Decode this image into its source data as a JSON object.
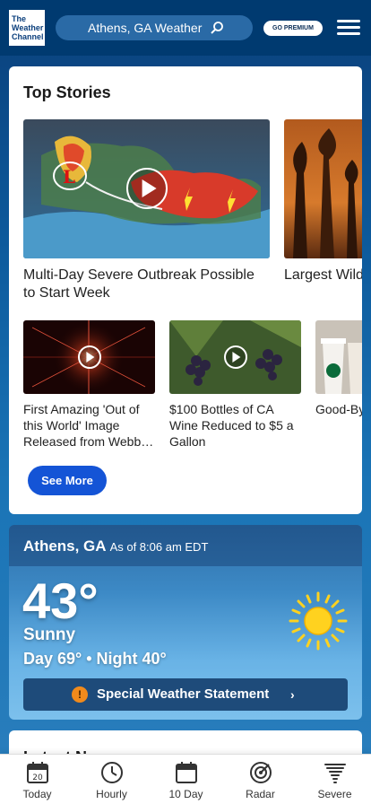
{
  "header": {
    "logo_lines": [
      "The",
      "Weather",
      "Channel"
    ],
    "search_text": "Athens, GA Weather",
    "premium_label": "GO PREMIUM"
  },
  "top_stories": {
    "title": "Top Stories",
    "featured": [
      {
        "caption": "Multi-Day Severe Outbreak Possible to Start Week",
        "video": true
      },
      {
        "caption": "Largest Wildfire... Continues to...",
        "video": false
      }
    ],
    "small": [
      {
        "caption": "First Amazing 'Out of this World' Image Released from Webb…",
        "video": true
      },
      {
        "caption": "$100 Bottles of CA Wine Reduced to $5 a Gallon",
        "video": true
      },
      {
        "caption": "Good-By... Cups at S...",
        "video": false
      }
    ],
    "see_more_label": "See More"
  },
  "current": {
    "location": "Athens, GA",
    "as_of": "As of 8:06 am EDT",
    "temperature": "43°",
    "condition": "Sunny",
    "day_night": "Day 69° • Night 40°",
    "alert_label": "Special Weather Statement",
    "alert_icon": "!",
    "chevron": "›"
  },
  "latest_news": {
    "title": "Latest News"
  },
  "bottom_nav": [
    {
      "label": "Today",
      "icon": "calendar-day-icon",
      "day_number": "20"
    },
    {
      "label": "Hourly",
      "icon": "clock-icon"
    },
    {
      "label": "10 Day",
      "icon": "calendar-icon"
    },
    {
      "label": "Radar",
      "icon": "radar-icon"
    },
    {
      "label": "Severe",
      "icon": "tornado-icon"
    }
  ],
  "colors": {
    "header_bg": "#003a70",
    "accent_button": "#1454d6",
    "alert_icon": "#f08a1c"
  }
}
